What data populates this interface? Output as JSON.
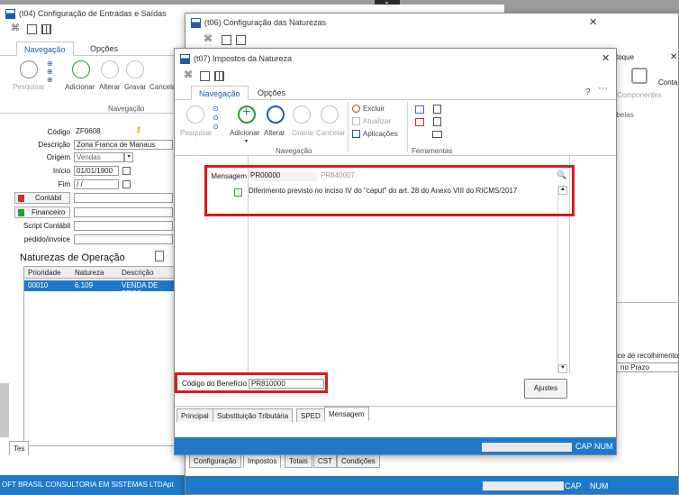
{
  "background_window": {
    "title": "(t04)  Configuração de Entradas e Saídas",
    "tabs": [
      "Navegação",
      "Opções"
    ],
    "ribbon_labels": [
      "Pesquisar",
      "Adicionar",
      "Alterar",
      "Gravar",
      "Cancelar"
    ],
    "group_label": "Navegação",
    "fields": {
      "codigo_label": "Código",
      "codigo_value": "ZF0608",
      "descricao_label": "Descrição",
      "descricao_value": "Zona Franca de Manaus",
      "origem_label": "Origem",
      "origem_value": "Vendas",
      "inicio_label": "Início",
      "inicio_value": "01/01/1900",
      "fim_label": "Fim",
      "fim_value": " / /",
      "contabil_label": "Contábil",
      "financeiro_label": "Financeiro",
      "script_label": "Script Contábil",
      "pedido_label": "pedido/invoice"
    },
    "section_title": "Naturezas de Operação",
    "table": {
      "headers": [
        "Prioridade",
        "Natureza",
        "Descrição"
      ],
      "rows": [
        [
          "00010",
          "6.109",
          "VENDA DE PROD"
        ]
      ]
    },
    "bottom_tab": "Tes",
    "status_text": "OFT BRASIL CONSULTORIA EM SISTEMAS LTDA",
    "status_right": "pt"
  },
  "middle_window": {
    "title": "(t06)  Configuração das Naturezas",
    "right_labels": {
      "estoque": "stoque",
      "componentes": "Componentes",
      "contab": "Contab",
      "tabelas": "abelas",
      "recolhimento": "ice de recolhimento",
      "prazo": "no Prazo"
    },
    "bottom_tabs": [
      "Configuração",
      "Impostos",
      "Totais",
      "CST",
      "Condições"
    ],
    "status_cap": "CAP",
    "status_num": "NUM"
  },
  "front_window": {
    "title": "(t07)  Impostos da Natureza",
    "tabs": [
      "Navegação",
      "Opções"
    ],
    "help": "?",
    "more": "···",
    "ribbon": {
      "pesquisar": "Pesquisar",
      "adicionar": "Adicionar",
      "alterar": "Alterar",
      "gravar": "Gravar",
      "cancelar": "Cancelar",
      "excluir": "Excluir",
      "atualizar": "Atualizar",
      "aplicacoes": "Aplicações",
      "group_navegacao": "Navegação",
      "group_ferramentas": "Ferramentas"
    },
    "mensagem": {
      "label": "Mensagem",
      "code": "PR00000",
      "code2": "PR840007",
      "text": "Diferimento previsto no inciso IV do \"caput\" do art. 28 do Anexo VIII do RICMS/2017"
    },
    "beneficio": {
      "label": "Código do Benefício",
      "value": "PR810000"
    },
    "ajustes_button": "Ajustes",
    "bottom_tabs": [
      "Principal",
      "Substituição Tributária",
      "SPED",
      "Mensagem"
    ],
    "status_cap": "CAP",
    "status_num": "NUM"
  },
  "colors": {
    "accent": "#1f79c8",
    "highlight": "#dd1a1a",
    "selection": "#1f79c8"
  }
}
